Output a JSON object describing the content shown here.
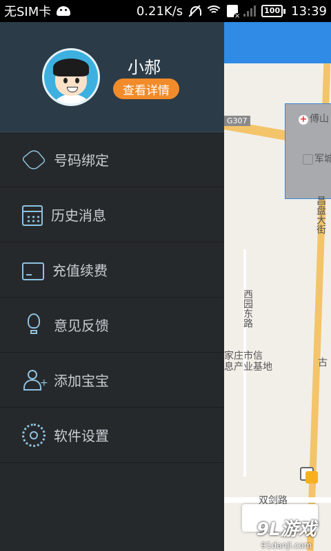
{
  "status_bar": {
    "carrier": "无SIM卡",
    "speed": "0.21K/s",
    "battery": "100",
    "time": "13:39"
  },
  "drawer": {
    "profile": {
      "name": "小郝",
      "detail_button": "查看详情"
    },
    "menu": [
      {
        "label": "号码绑定",
        "icon": "phone-icon"
      },
      {
        "label": "历史消息",
        "icon": "calendar-icon"
      },
      {
        "label": "充值续费",
        "icon": "wallet-icon"
      },
      {
        "label": "意见反馈",
        "icon": "lightbulb-icon"
      },
      {
        "label": "添加宝宝",
        "icon": "add-user-icon"
      },
      {
        "label": "软件设置",
        "icon": "gear-icon"
      }
    ]
  },
  "map": {
    "road_badge": "G307",
    "labels": {
      "hospital": "傅山",
      "military": "军城",
      "changpan_street": "昌盘大街",
      "xiyuan_east_road": "西园东路",
      "base_line1": "家庄市信",
      "base_line2": "息产业基地",
      "gu": "古",
      "shuangjian_road": "双剑路"
    }
  },
  "watermark": {
    "logo": "9L游戏",
    "domain": "91danji.com"
  },
  "colors": {
    "drawer_bg": "#26292c",
    "profile_bg": "#2b3b48",
    "accent_orange": "#f28b2a",
    "icon_blue": "#8fc4e0",
    "map_header_blue": "#2f8be6"
  }
}
